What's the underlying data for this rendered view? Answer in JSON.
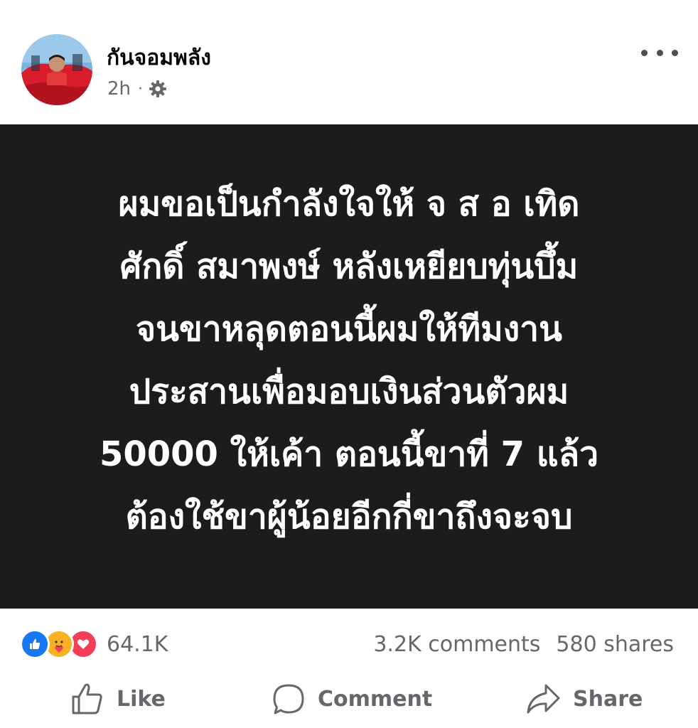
{
  "post": {
    "author": "กันจอมพลัง",
    "time": "2h",
    "separator": "·",
    "privacy_icon": "gear-icon",
    "text_lines": [
      "ผมขอเป็นกำลังใจให้ จ ส อ เทิด",
      "ศักดิ์ สมาพงษ์ หลังเหยียบทุ่นบึ้ม",
      "จนขาหลุดตอนนี้ผมให้ทีมงาน",
      "ประสานเพื่อมอบเงินส่วนตัวผม",
      "50000 ให้เค้า ตอนนี้ขาที่ 7 แล้ว",
      "ต้องใช้ขาผู้น้อยอีกกี่ขาถึงจะจบ"
    ],
    "background_color": "#1c1c1c"
  },
  "stats": {
    "reactions": [
      "like-icon",
      "care-icon",
      "love-icon"
    ],
    "reaction_count": "64.1K",
    "comments": "3.2K comments",
    "shares": "580 shares"
  },
  "actions": {
    "like": "Like",
    "comment": "Comment",
    "share": "Share"
  },
  "colors": {
    "secondary_text": "#65676b",
    "like_blue": "#1877f2",
    "love_red": "#f33e58",
    "care_yellow": "#f7b125"
  }
}
